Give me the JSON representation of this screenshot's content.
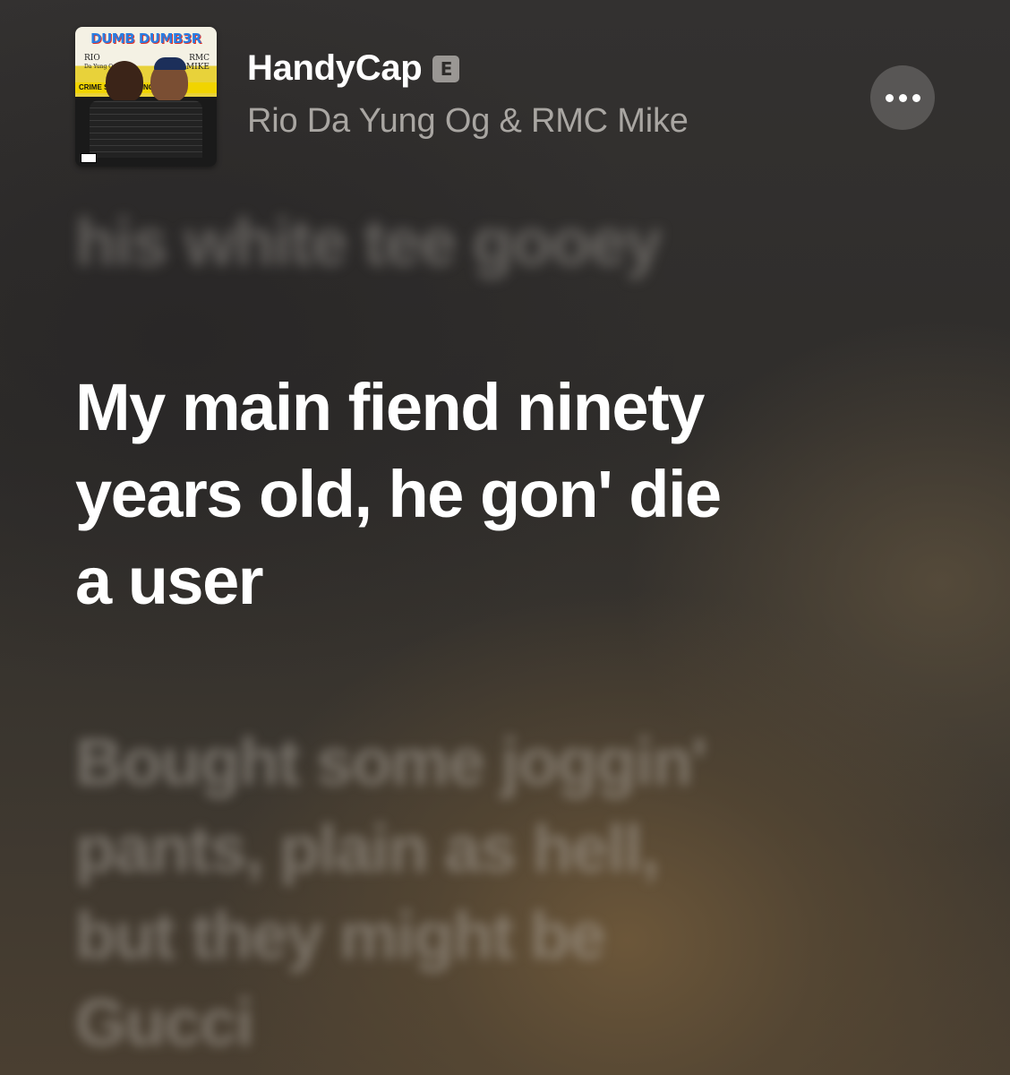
{
  "track": {
    "title": "HandyCap",
    "explicit_badge": "E",
    "artist": "Rio Da Yung Og & RMC Mike"
  },
  "album_art": {
    "title": "DUMB DUMB3R",
    "left_name": "RIO",
    "left_sub": "Da Yung Og",
    "right_name": "RMC",
    "right_sub": "MIKE",
    "tape_text": "CRIME SCENE DO NOT CROSS"
  },
  "more_button": {
    "icon": "ellipsis-icon"
  },
  "lyrics": {
    "previous": "his white tee gooey",
    "current": "My main fiend ninety\nyears old, he gon' die\na user",
    "next": "Bought some joggin'\npants, plain as hell,\nbut they might be\nGucci"
  },
  "colors": {
    "primary_text": "#ffffff",
    "secondary_text": "#a9a6a2",
    "explicit_badge_bg": "#9a9794",
    "tape_yellow": "#f1d400"
  }
}
